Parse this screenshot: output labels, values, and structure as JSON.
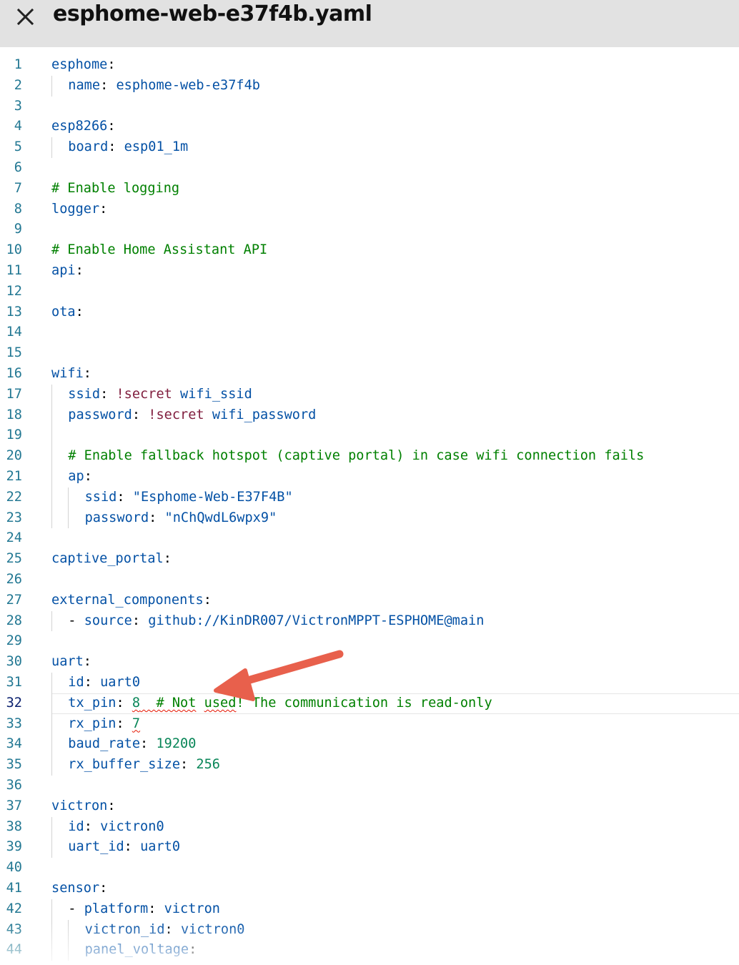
{
  "header": {
    "title": "esphome-web-e37f4b.yaml",
    "close_icon": "close-icon"
  },
  "editor": {
    "active_line": 32,
    "lines": [
      {
        "n": "1",
        "indent": 0,
        "tokens": [
          [
            "k",
            "esphome"
          ],
          [
            "p",
            ":"
          ]
        ]
      },
      {
        "n": "2",
        "indent": 1,
        "tokens": [
          [
            "k",
            "name"
          ],
          [
            "p",
            ": "
          ],
          [
            "v",
            "esphome-web-e37f4b"
          ]
        ]
      },
      {
        "n": "3",
        "indent": 0,
        "tokens": []
      },
      {
        "n": "4",
        "indent": 0,
        "tokens": [
          [
            "k",
            "esp8266"
          ],
          [
            "p",
            ":"
          ]
        ]
      },
      {
        "n": "5",
        "indent": 1,
        "tokens": [
          [
            "k",
            "board"
          ],
          [
            "p",
            ": "
          ],
          [
            "v",
            "esp01_1m"
          ]
        ]
      },
      {
        "n": "6",
        "indent": 0,
        "tokens": []
      },
      {
        "n": "7",
        "indent": 0,
        "tokens": [
          [
            "c",
            "# Enable logging"
          ]
        ]
      },
      {
        "n": "8",
        "indent": 0,
        "tokens": [
          [
            "k",
            "logger"
          ],
          [
            "p",
            ":"
          ]
        ]
      },
      {
        "n": "9",
        "indent": 0,
        "tokens": []
      },
      {
        "n": "10",
        "indent": 0,
        "tokens": [
          [
            "c",
            "# Enable Home Assistant API"
          ]
        ]
      },
      {
        "n": "11",
        "indent": 0,
        "tokens": [
          [
            "k",
            "api"
          ],
          [
            "p",
            ":"
          ]
        ]
      },
      {
        "n": "12",
        "indent": 0,
        "tokens": []
      },
      {
        "n": "13",
        "indent": 0,
        "tokens": [
          [
            "k",
            "ota"
          ],
          [
            "p",
            ":"
          ]
        ]
      },
      {
        "n": "14",
        "indent": 0,
        "tokens": []
      },
      {
        "n": "15",
        "indent": 0,
        "tokens": []
      },
      {
        "n": "16",
        "indent": 0,
        "tokens": [
          [
            "k",
            "wifi"
          ],
          [
            "p",
            ":"
          ]
        ]
      },
      {
        "n": "17",
        "indent": 1,
        "tokens": [
          [
            "k",
            "ssid"
          ],
          [
            "p",
            ": "
          ],
          [
            "tag",
            "!secret"
          ],
          [
            "p",
            " "
          ],
          [
            "v",
            "wifi_ssid"
          ]
        ]
      },
      {
        "n": "18",
        "indent": 1,
        "tokens": [
          [
            "k",
            "password"
          ],
          [
            "p",
            ": "
          ],
          [
            "tag",
            "!secret"
          ],
          [
            "p",
            " "
          ],
          [
            "v",
            "wifi_password"
          ]
        ]
      },
      {
        "n": "19",
        "indent": 0,
        "tokens": []
      },
      {
        "n": "20",
        "indent": 1,
        "tokens": [
          [
            "c",
            "# Enable fallback hotspot (captive portal) in case wifi connection fails"
          ]
        ]
      },
      {
        "n": "21",
        "indent": 1,
        "tokens": [
          [
            "k",
            "ap"
          ],
          [
            "p",
            ":"
          ]
        ]
      },
      {
        "n": "22",
        "indent": 2,
        "tokens": [
          [
            "k",
            "ssid"
          ],
          [
            "p",
            ": "
          ],
          [
            "s",
            "\"Esphome-Web-E37F4B\""
          ]
        ]
      },
      {
        "n": "23",
        "indent": 2,
        "tokens": [
          [
            "k",
            "password"
          ],
          [
            "p",
            ": "
          ],
          [
            "s",
            "\"nChQwdL6wpx9\""
          ]
        ]
      },
      {
        "n": "24",
        "indent": 0,
        "tokens": []
      },
      {
        "n": "25",
        "indent": 0,
        "tokens": [
          [
            "k",
            "captive_portal"
          ],
          [
            "p",
            ":"
          ]
        ]
      },
      {
        "n": "26",
        "indent": 0,
        "tokens": []
      },
      {
        "n": "27",
        "indent": 0,
        "tokens": [
          [
            "k",
            "external_components"
          ],
          [
            "p",
            ":"
          ]
        ]
      },
      {
        "n": "28",
        "indent": 1,
        "tokens": [
          [
            "p",
            "- "
          ],
          [
            "k",
            "source"
          ],
          [
            "p",
            ": "
          ],
          [
            "v",
            "github://KinDR007/VictronMPPT-ESPHOME@main"
          ]
        ]
      },
      {
        "n": "29",
        "indent": 0,
        "tokens": []
      },
      {
        "n": "30",
        "indent": 0,
        "tokens": [
          [
            "k",
            "uart"
          ],
          [
            "p",
            ":"
          ]
        ]
      },
      {
        "n": "31",
        "indent": 1,
        "tokens": [
          [
            "k",
            "id"
          ],
          [
            "p",
            ": "
          ],
          [
            "v",
            "uart0"
          ]
        ]
      },
      {
        "n": "32",
        "indent": 1,
        "tokens": [
          [
            "k",
            "tx_pin"
          ],
          [
            "p",
            ": "
          ],
          [
            "n~",
            "8"
          ],
          [
            "c~",
            "  # Not"
          ],
          [
            "c",
            " "
          ],
          [
            "c~",
            "used"
          ],
          [
            "c",
            "! The communication is read-only"
          ]
        ]
      },
      {
        "n": "33",
        "indent": 1,
        "tokens": [
          [
            "k",
            "rx_pin"
          ],
          [
            "p",
            ": "
          ],
          [
            "n~",
            "7"
          ]
        ]
      },
      {
        "n": "34",
        "indent": 1,
        "tokens": [
          [
            "k",
            "baud_rate"
          ],
          [
            "p",
            ": "
          ],
          [
            "n",
            "19200"
          ]
        ]
      },
      {
        "n": "35",
        "indent": 1,
        "tokens": [
          [
            "k",
            "rx_buffer_size"
          ],
          [
            "p",
            ": "
          ],
          [
            "n",
            "256"
          ]
        ]
      },
      {
        "n": "36",
        "indent": 0,
        "tokens": []
      },
      {
        "n": "37",
        "indent": 0,
        "tokens": [
          [
            "k",
            "victron"
          ],
          [
            "p",
            ":"
          ]
        ]
      },
      {
        "n": "38",
        "indent": 1,
        "tokens": [
          [
            "k",
            "id"
          ],
          [
            "p",
            ": "
          ],
          [
            "v",
            "victron0"
          ]
        ]
      },
      {
        "n": "39",
        "indent": 1,
        "tokens": [
          [
            "k",
            "uart_id"
          ],
          [
            "p",
            ": "
          ],
          [
            "v",
            "uart0"
          ]
        ]
      },
      {
        "n": "40",
        "indent": 0,
        "tokens": []
      },
      {
        "n": "41",
        "indent": 0,
        "tokens": [
          [
            "k",
            "sensor"
          ],
          [
            "p",
            ":"
          ]
        ]
      },
      {
        "n": "42",
        "indent": 1,
        "tokens": [
          [
            "p",
            "- "
          ],
          [
            "k",
            "platform"
          ],
          [
            "p",
            ": "
          ],
          [
            "v",
            "victron"
          ]
        ]
      },
      {
        "n": "43",
        "indent": 2,
        "tokens": [
          [
            "k",
            "victron_id"
          ],
          [
            "p",
            ": "
          ],
          [
            "v",
            "victron0"
          ]
        ]
      },
      {
        "n": "44",
        "indent": 2,
        "tokens": [
          [
            "k",
            "panel_voltage"
          ],
          [
            "p",
            ":"
          ]
        ]
      }
    ]
  },
  "annotation": {
    "icon": "arrow-annotation-icon",
    "color": "#e8604c"
  }
}
